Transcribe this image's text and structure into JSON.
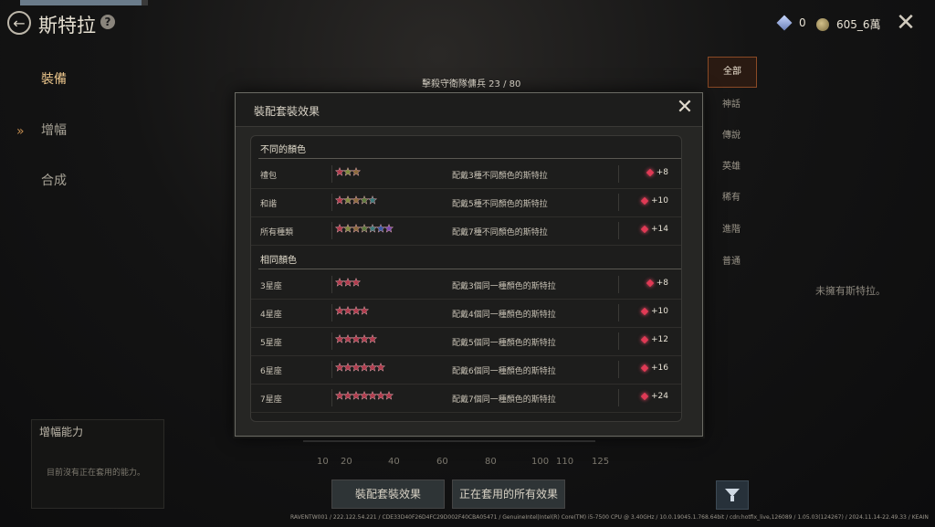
{
  "header": {
    "title": "斯特拉",
    "hp_fraction": 0.95
  },
  "currency": {
    "diamond": "0",
    "gold": "605_6萬"
  },
  "sidebar": {
    "items": [
      {
        "label": "裝備"
      },
      {
        "label": "增幅"
      },
      {
        "label": "合成"
      }
    ]
  },
  "progress": {
    "label": "擊殺守衛隊傭兵 23 / 80"
  },
  "filters": [
    "全部",
    "神話",
    "傳說",
    "英雄",
    "稀有",
    "進階",
    "普通"
  ],
  "empty_text": "未擁有斯特拉。",
  "ability_panel": {
    "heading": "增幅能力",
    "text": "目前沒有正在套用的能力。"
  },
  "axis_ticks": [
    "10",
    "20",
    "40",
    "60",
    "80",
    "100",
    "110",
    "125"
  ],
  "buttons": {
    "set_effect": "裝配套裝效果",
    "active_effects": "正在套用的所有效果"
  },
  "footer": "RAVENTW001 / 222.122.54.221 / CDE33D40F26D4FC29D002F40CBA05471 / GenuineIntel|Intel(R) Core(TM) i5-7500 CPU @ 3.40GHz / 10.0.19045.1.768.64bit / cdn:hotfix_live,126089 / 1.05.03(124267) / 2024.11.14-22.49.33 / KEAIN",
  "modal": {
    "title": "裝配套裝效果",
    "sections": [
      {
        "heading": "不同的顏色",
        "rows": [
          {
            "name": "禮包",
            "stars": [
              "#b13a4c",
              "#7d8a3d",
              "#8b6a3c"
            ],
            "desc": "配戴3種不同顏色的斯特拉",
            "value": "+8"
          },
          {
            "name": "和諧",
            "stars": [
              "#b13a4c",
              "#7d8a3d",
              "#8b6a3c",
              "#5a7a3c",
              "#3a7a7a"
            ],
            "desc": "配戴5種不同顏色的斯特拉",
            "value": "+10"
          },
          {
            "name": "所有種類",
            "stars": [
              "#b13a4c",
              "#7d8a3d",
              "#8b6a3c",
              "#5a7a3c",
              "#3a7a7a",
              "#3a5aa8",
              "#7a4ab1"
            ],
            "desc": "配戴7種不同顏色的斯特拉",
            "value": "+14"
          }
        ]
      },
      {
        "heading": "相同顏色",
        "rows": [
          {
            "name": "3星座",
            "stars": [
              "#b13a4c",
              "#b13a4c",
              "#b13a4c"
            ],
            "desc": "配戴3個同一種顏色的斯特拉",
            "value": "+8"
          },
          {
            "name": "4星座",
            "stars": [
              "#b13a4c",
              "#b13a4c",
              "#b13a4c",
              "#b13a4c"
            ],
            "desc": "配戴4個同一種顏色的斯特拉",
            "value": "+10"
          },
          {
            "name": "5星座",
            "stars": [
              "#b13a4c",
              "#b13a4c",
              "#b13a4c",
              "#b13a4c",
              "#b13a4c"
            ],
            "desc": "配戴5個同一種顏色的斯特拉",
            "value": "+12"
          },
          {
            "name": "6星座",
            "stars": [
              "#b13a4c",
              "#b13a4c",
              "#b13a4c",
              "#b13a4c",
              "#b13a4c",
              "#b13a4c"
            ],
            "desc": "配戴6個同一種顏色的斯特拉",
            "value": "+16"
          },
          {
            "name": "7星座",
            "stars": [
              "#b13a4c",
              "#b13a4c",
              "#b13a4c",
              "#b13a4c",
              "#b13a4c",
              "#b13a4c",
              "#b13a4c"
            ],
            "desc": "配戴7個同一種顏色的斯特拉",
            "value": "+24"
          }
        ]
      }
    ]
  }
}
